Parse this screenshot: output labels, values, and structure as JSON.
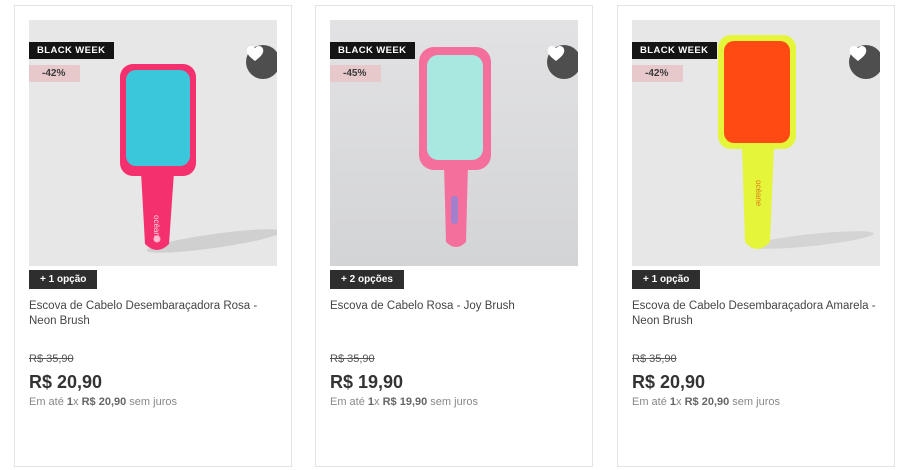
{
  "products": [
    {
      "badge": "BLACK WEEK",
      "discount": "-42%",
      "options": "+ 1 opção",
      "name": "Escova de Cabelo Desembaraçadora Rosa - Neon Brush",
      "old_price": "R$ 35,90",
      "price": "R$ 20,90",
      "inst_prefix": "Em até ",
      "inst_count": "1",
      "inst_times": "x ",
      "inst_value": "R$ 20,90",
      "inst_suffix": " sem juros",
      "brush_body_color": "#f5306e",
      "brush_bristle_color": "#3ac7dc",
      "brand_text": "océane"
    },
    {
      "badge": "BLACK WEEK",
      "discount": "-45%",
      "options": "+ 2 opções",
      "name": "Escova de Cabelo Rosa - Joy Brush",
      "old_price": "R$ 35,90",
      "price": "R$ 19,90",
      "inst_prefix": "Em até ",
      "inst_count": "1",
      "inst_times": "x ",
      "inst_value": "R$ 19,90",
      "inst_suffix": " sem juros",
      "brush_body_color": "#f46f9c",
      "brush_bristle_color": "#a9e8e1",
      "brand_text": "océane"
    },
    {
      "badge": "BLACK WEEK",
      "discount": "-42%",
      "options": "+ 1 opção",
      "name": "Escova de Cabelo Desembaraçadora Amarela - Neon Brush",
      "old_price": "R$ 35,90",
      "price": "R$ 20,90",
      "inst_prefix": "Em até ",
      "inst_count": "1",
      "inst_times": "x ",
      "inst_value": "R$ 20,90",
      "inst_suffix": " sem juros",
      "brush_body_color": "#e4f53a",
      "brush_bristle_color": "#ff4a14",
      "brand_text": "océane"
    }
  ],
  "icons": {
    "favorite": "heart-icon"
  },
  "colors": {
    "badge_bg": "#141414",
    "discount_bg": "#e7c9cc",
    "fav_bg": "#4e4e4e",
    "options_bg": "#2e2e2e"
  }
}
